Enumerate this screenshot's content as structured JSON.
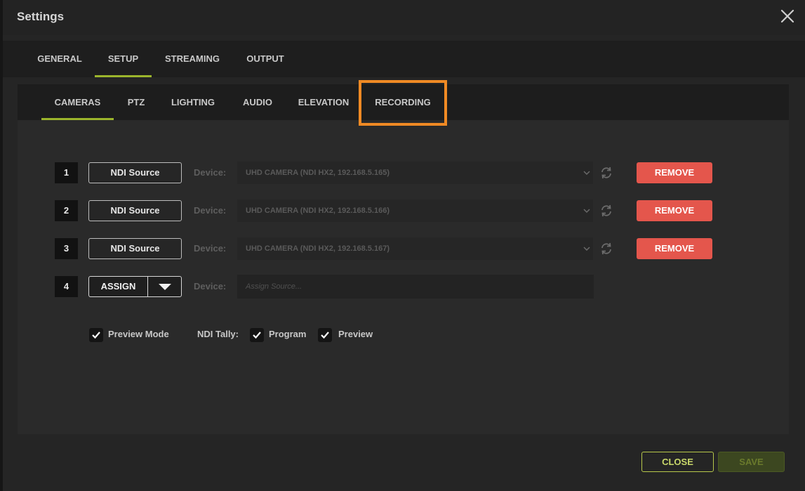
{
  "window": {
    "title": "Settings"
  },
  "main_tabs": [
    {
      "label": "GENERAL"
    },
    {
      "label": "SETUP",
      "active": true
    },
    {
      "label": "STREAMING"
    },
    {
      "label": "OUTPUT"
    }
  ],
  "sub_tabs": [
    {
      "label": "CAMERAS",
      "active": true
    },
    {
      "label": "PTZ"
    },
    {
      "label": "LIGHTING"
    },
    {
      "label": "AUDIO"
    },
    {
      "label": "ELEVATION"
    },
    {
      "label": "RECORDING",
      "highlighted": true
    }
  ],
  "cameras": [
    {
      "number": "1",
      "source_label": "NDI Source",
      "device_label": "Device:",
      "device_value": "UHD CAMERA (NDI HX2, 192.168.5.165)",
      "remove_label": "REMOVE"
    },
    {
      "number": "2",
      "source_label": "NDI Source",
      "device_label": "Device:",
      "device_value": "UHD CAMERA (NDI HX2, 192.168.5.166)",
      "remove_label": "REMOVE"
    },
    {
      "number": "3",
      "source_label": "NDI Source",
      "device_label": "Device:",
      "device_value": "UHD CAMERA (NDI HX2, 192.168.5.167)",
      "remove_label": "REMOVE"
    },
    {
      "number": "4",
      "assign_label": "ASSIGN",
      "device_label": "Device:",
      "device_placeholder": "Assign Source..."
    }
  ],
  "options": {
    "preview_mode": {
      "label": "Preview Mode",
      "checked": true
    },
    "ndi_tally_label": "NDI Tally:",
    "program": {
      "label": "Program",
      "checked": true
    },
    "preview": {
      "label": "Preview",
      "checked": true
    }
  },
  "footer": {
    "close_label": "CLOSE",
    "save_label": "SAVE"
  },
  "colors": {
    "accent": "#9cb52c",
    "remove": "#e4564c",
    "highlight": "#f08a24"
  }
}
